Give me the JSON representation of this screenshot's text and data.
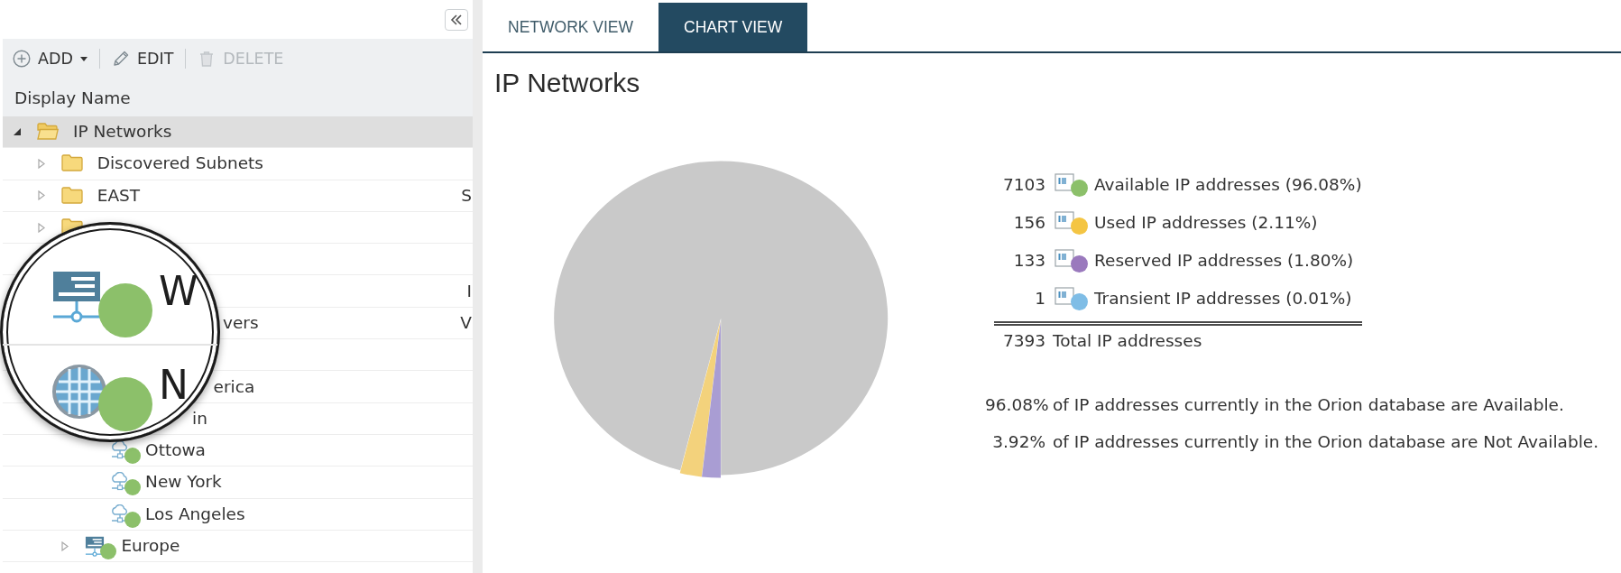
{
  "sidebar": {
    "toolbar": [
      {
        "label": "ADD",
        "kind": "add",
        "dropdown": true,
        "disabled": false
      },
      {
        "label": "EDIT",
        "kind": "edit",
        "dropdown": false,
        "disabled": false
      },
      {
        "label": "DELETE",
        "kind": "delete",
        "dropdown": false,
        "disabled": true
      }
    ],
    "column_header": "Display Name",
    "tree": [
      {
        "label": "IP Networks",
        "kind": "folder",
        "expanded": true,
        "selected": true,
        "children": [
          {
            "label": "Discovered Subnets",
            "kind": "folder",
            "expanded": false,
            "selected": false
          },
          {
            "label": "EAST",
            "kind": "folder",
            "expanded": false,
            "selected": false,
            "column_2": "S"
          },
          {
            "kind": "folder",
            "expanded": false,
            "selected": false
          },
          {
            "selected": false
          },
          {
            "selected": false,
            "column_2": "I"
          },
          {
            "label": "vers",
            "selected": false,
            "column_2": "V"
          },
          {
            "selected": false
          },
          {
            "label": "erica",
            "selected": false,
            "children": [
              {
                "label": "in",
                "selected": false,
                "children": [
                  {
                    "label": "Ottowa",
                    "kind": "network",
                    "color": "#8cc06a",
                    "selected": false
                  },
                  {
                    "label": "New York",
                    "kind": "network",
                    "color": "#8cc06a",
                    "selected": false
                  },
                  {
                    "label": "Los Angeles",
                    "kind": "network",
                    "color": "#8cc06a",
                    "selected": false
                  }
                ]
              },
              {
                "label": "Europe",
                "kind": "server",
                "color": "#8cc06a",
                "expanded": false,
                "selected": false
              }
            ]
          }
        ]
      }
    ],
    "magnifier": {
      "items": [
        {
          "kind": "server",
          "text": "W",
          "color": "#8cc06a"
        },
        {
          "kind": "globe",
          "text": "N",
          "color": "#8cc06a"
        }
      ]
    }
  },
  "main": {
    "tabs": [
      {
        "label": "NETWORK VIEW",
        "selected": false
      },
      {
        "label": "CHART VIEW",
        "selected": true
      }
    ],
    "title": "IP Networks",
    "chart_data": {
      "type": "pie",
      "values": [
        96.08,
        2.11,
        1.8
      ]
    },
    "legend": [
      {
        "count": "7103",
        "label": "Available IP addresses (96.08%)",
        "color": "#8cc06a"
      },
      {
        "count": "156",
        "label": "Used IP addresses (2.11%)",
        "color": "#f4c543"
      },
      {
        "count": "133",
        "label": "Reserved IP addresses (1.80%)",
        "color": "#9a79bd"
      },
      {
        "count": "1",
        "label": "Transient IP addresses (0.01%)",
        "color": "#7fbde6"
      }
    ],
    "total": {
      "count": "7393",
      "label": "Total IP addresses"
    },
    "summary": [
      {
        "percent": "96.08%",
        "text": "of IP addresses currently in the Orion database are Available."
      },
      {
        "percent": "3.92%",
        "text": "of IP addresses currently in the Orion database are Not Available."
      }
    ]
  }
}
